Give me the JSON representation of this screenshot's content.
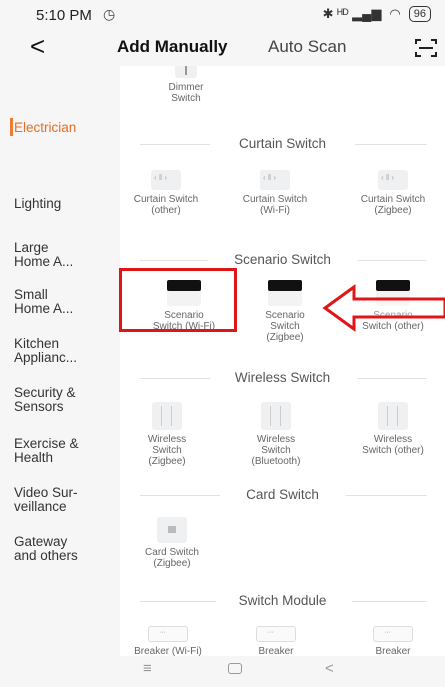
{
  "status_bar": {
    "time": "5:10 PM",
    "signal": "✱ ᴴᴰ ▂▄▆",
    "wifi": "◠",
    "battery": "96"
  },
  "nav": {
    "back": "<",
    "tab_active": "Add Manually",
    "tab_other": "Auto Scan"
  },
  "sidebar": {
    "items": [
      "Electrician",
      "Lighting",
      "Large\nHome A...",
      "Small\nHome A...",
      "Kitchen\nApplianc...",
      "Security &\nSensors",
      "Exercise &\nHealth",
      "Video Sur-\nveillance",
      "Gateway\nand others"
    ]
  },
  "content": {
    "top_device": "Dimmer\nSwitch",
    "sections": {
      "curtain": "Curtain Switch",
      "scenario": "Scenario Switch",
      "wireless": "Wireless Switch",
      "card": "Card Switch",
      "module": "Switch Module"
    },
    "curtain_devices": [
      "Curtain Switch\n(other)",
      "Curtain Switch\n(Wi-Fi)",
      "Curtain Switch\n(Zigbee)"
    ],
    "scenario_devices": [
      "Scenario\nSwitch (Wi-Fi)",
      "Scenario\nSwitch\n(Zigbee)",
      "Scenario\nSwitch (other)"
    ],
    "wireless_devices": [
      "Wireless\nSwitch\n(Zigbee)",
      "Wireless\nSwitch\n(Bluetooth)",
      "Wireless\nSwitch (other)"
    ],
    "card_devices": [
      "Card Switch\n(Zigbee)"
    ],
    "module_devices": [
      "Breaker (Wi-Fi)",
      "Breaker",
      "Breaker"
    ]
  },
  "colors": {
    "accent": "#e46e24",
    "highlight": "#e01616"
  }
}
